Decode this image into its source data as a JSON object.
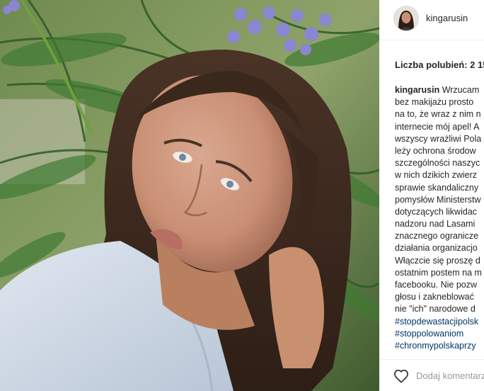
{
  "post": {
    "username": "kingarusin",
    "likes_label": "Liczba polubień: 2 15",
    "caption_user": "kingarusin",
    "caption_lines": [
      " Wrzucam",
      "bez makijażu prosto",
      "na to, że wraz z nim n",
      "internecie mój apel! A",
      "wszyscy wrażliwi Pola",
      "leży ochrona środow",
      "szczególności naszyc",
      "w nich dzikich zwierz",
      "sprawie skandaliczny",
      "pomysłów Ministerstw",
      "dotyczących likwidac",
      "nadzoru nad Lasami",
      "znacznego ogranicze",
      "działania organizacjo",
      "Włączcie się proszę d",
      "ostatnim postem na m",
      "facebooku. Nie pozw",
      "głosu i zakneblować",
      "nie \"ich\" narodowe d"
    ],
    "hashtags": [
      "#stopdewastacjipolsk",
      "#stoppolowaniom",
      "#chronmypolskaprzy"
    ]
  },
  "comment": {
    "placeholder": "Dodaj komentarz..."
  },
  "icons": {
    "like": "heart-icon",
    "avatar": "profile-avatar"
  },
  "colors": {
    "text": "#262626",
    "hashtag": "#003569",
    "placeholder": "#999999",
    "border": "#efefef"
  }
}
